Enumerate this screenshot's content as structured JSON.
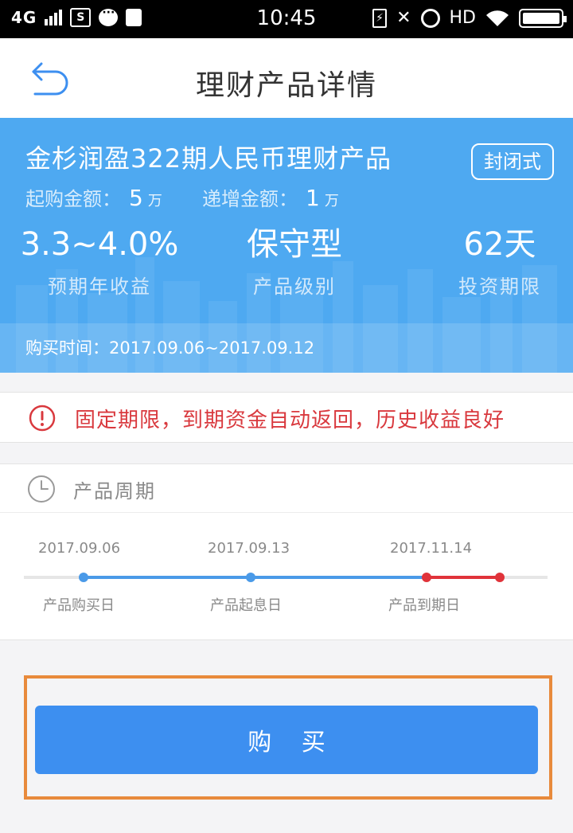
{
  "status_bar": {
    "network": "4G",
    "time": "10:45",
    "hd": "HD",
    "icons": [
      "signal-icon",
      "s-icon",
      "message-icon",
      "bag-icon",
      "charging-icon",
      "mute-icon",
      "alarm-icon",
      "wifi-icon",
      "battery-icon"
    ]
  },
  "header": {
    "title": "理财产品详情",
    "back_icon": "back-arrow-icon"
  },
  "product": {
    "name": "金杉润盈322期人民币理财产品",
    "type_badge": "封闭式",
    "min_purchase_label": "起购金额：",
    "min_purchase_value": "5",
    "min_purchase_unit": "万",
    "increment_label": "递增金额：",
    "increment_value": "1",
    "increment_unit": "万",
    "stats": [
      {
        "value": "3.3~4.0%",
        "label": "预期年收益"
      },
      {
        "value": "保守型",
        "label": "产品级别"
      },
      {
        "value": "62天",
        "label": "投资期限"
      }
    ],
    "purchase_time": "购买时间：2017.09.06~2017.09.12"
  },
  "notice": {
    "text": "固定期限，到期资金自动返回，历史收益良好",
    "icon": "exclamation-icon"
  },
  "cycle": {
    "title": "产品周期",
    "icon": "clock-icon",
    "points": [
      {
        "date": "2017.09.06",
        "label": "产品购买日"
      },
      {
        "date": "2017.09.13",
        "label": "产品起息日"
      },
      {
        "date": "2017.11.14",
        "label": "产品到期日"
      }
    ]
  },
  "buy_button": {
    "label": "购 买"
  },
  "colors": {
    "banner": "#4ea9f1",
    "accent_blue": "#3d8ff0",
    "alert_red": "#d9393e",
    "highlight_orange": "#e88a3c"
  }
}
